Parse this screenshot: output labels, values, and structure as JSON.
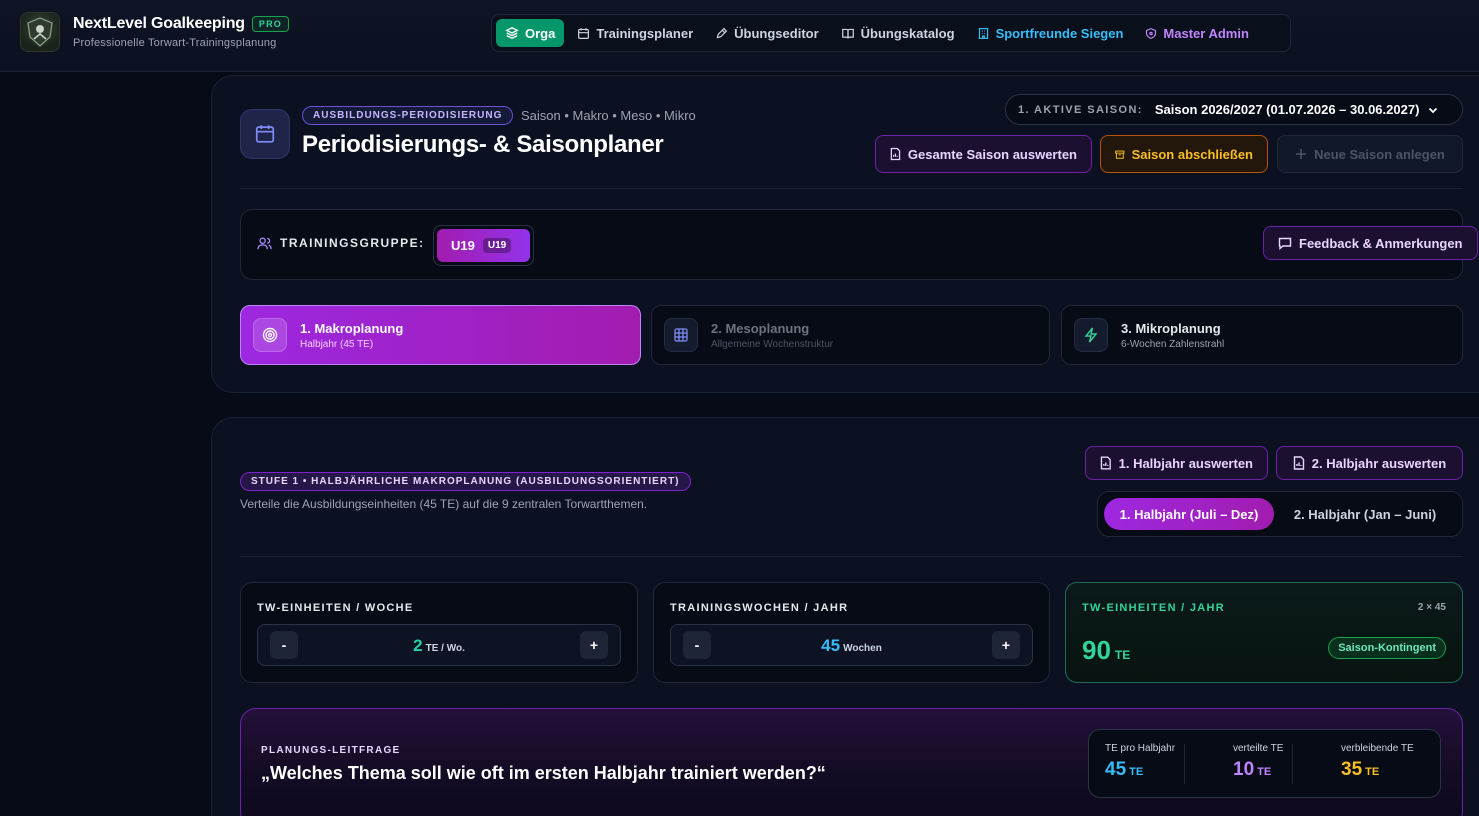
{
  "brand": {
    "title": "NextLevel Goalkeeping",
    "badge": "PRO",
    "subtitle": "Professionelle Torwart-Trainingsplanung",
    "logo_icon": "shield-logo-icon"
  },
  "nav": {
    "items": [
      {
        "label": "Orga",
        "icon": "layers-icon",
        "active": true
      },
      {
        "label": "Trainingsplaner",
        "icon": "calendar-icon"
      },
      {
        "label": "Übungseditor",
        "icon": "edit-icon"
      },
      {
        "label": "Übungskatalog",
        "icon": "book-icon"
      },
      {
        "label": "Sportfreunde Siegen",
        "icon": "building-icon"
      },
      {
        "label": "Master Admin",
        "icon": "shield-icon"
      }
    ]
  },
  "header": {
    "category_pill": "AUSBILDUNGS-PERIODISIERUNG",
    "breadcrumb": "Saison • Makro • Meso • Mikro",
    "title": "Periodisierungs- & Saisonplaner",
    "season_label": "1. AKTIVE SAISON:",
    "season_value": "Saison 2026/2027 (01.07.2026 – 30.06.2027)",
    "buttons": {
      "evaluate_season": "Gesamte Saison auswerten",
      "close_season": "Saison abschließen",
      "new_season": "Neue Saison anlegen"
    }
  },
  "group": {
    "label": "TRAININGSGRUPPE:",
    "selected": "U19",
    "selected_tag": "U19",
    "feedback_button": "Feedback & Anmerkungen"
  },
  "steps": [
    {
      "title": "1. Makroplanung",
      "subtitle": "Halbjahr (45 TE)",
      "icon": "target-icon",
      "active": true
    },
    {
      "title": "2. Mesoplanung",
      "subtitle": "Allgemeine Wochenstruktur",
      "icon": "grid-icon",
      "active": false
    },
    {
      "title": "3. Mikroplanung",
      "subtitle": "6-Wochen Zahlenstrahl",
      "icon": "lightning-icon",
      "active": false
    }
  ],
  "makro": {
    "stage_pill": "STUFE 1 • HALBJÄHRLICHE MAKROPLANUNG (AUSBILDUNGSORIENTIERT)",
    "description": "Verteile die Ausbildungseinheiten (45 TE) auf die 9 zentralen Torwartthemen.",
    "eval_h1": "1. Halbjahr auswerten",
    "eval_h2": "2. Halbjahr auswerten",
    "half_options": [
      "1. Halbjahr (Juli – Dez)",
      "2. Halbjahr (Jan – Juni)"
    ],
    "half_selected": 0
  },
  "stats": {
    "per_week": {
      "label": "TW-EINHEITEN / WOCHE",
      "value": "2",
      "unit": "TE / Wo.",
      "minus": "-",
      "plus": "+"
    },
    "weeks": {
      "label": "TRAININGSWOCHEN / JAHR",
      "value": "45",
      "unit": "Wochen",
      "minus": "-",
      "plus": "+"
    },
    "per_year": {
      "label": "TW-EINHEITEN / JAHR",
      "multiplier": "2 × 45",
      "value": "90",
      "unit": "TE",
      "badge": "Saison-Kontingent"
    }
  },
  "leitfrage": {
    "label": "PLANUNGS-LEITFRAGE",
    "question": "„Welches Thema soll wie oft im ersten Halbjahr trainiert werden?“",
    "stats": [
      {
        "label": "TE pro Halbjahr",
        "value": "45",
        "unit": "TE",
        "color": "#38bdf8"
      },
      {
        "label": "verteilte TE",
        "value": "10",
        "unit": "TE",
        "color": "#c084fc"
      },
      {
        "label": "verbleibende TE",
        "value": "35",
        "unit": "TE",
        "color": "#fbbf24"
      }
    ]
  }
}
